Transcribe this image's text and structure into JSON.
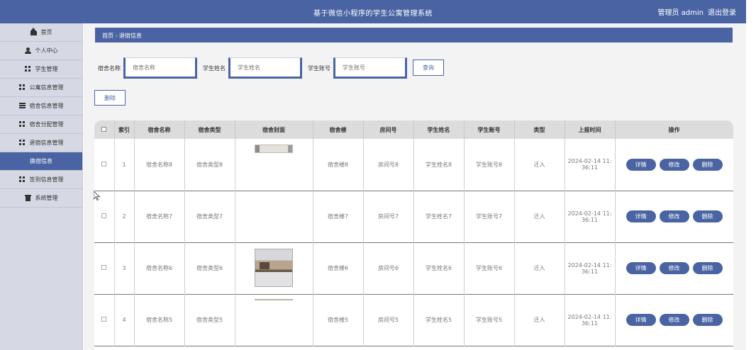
{
  "header": {
    "title": "基于微信小程序的学生公寓管理系统",
    "user_role": "管理员 admin",
    "logout": "退出登录"
  },
  "sidebar": {
    "items": [
      {
        "label": "首页",
        "icon": "home-icon",
        "active": false
      },
      {
        "label": "个人中心",
        "icon": "user-icon",
        "active": false
      },
      {
        "label": "学生管理",
        "icon": "grid-icon",
        "active": false
      },
      {
        "label": "公寓信息管理",
        "icon": "grid-icon",
        "active": false
      },
      {
        "label": "宿舍信息管理",
        "icon": "list-icon",
        "active": false
      },
      {
        "label": "宿舍分配管理",
        "icon": "grid-icon",
        "active": false
      },
      {
        "label": "退宿信息管理",
        "icon": "grid-icon",
        "active": false
      },
      {
        "label": "换宿信息",
        "icon": "",
        "active": true
      },
      {
        "label": "签到信息管理",
        "icon": "grid-icon",
        "active": false
      },
      {
        "label": "系统管理",
        "icon": "trash-icon",
        "active": false
      }
    ]
  },
  "breadcrumb": {
    "home": "首页",
    "sep": "-",
    "current": "退宿信息"
  },
  "search": {
    "fields": [
      {
        "label": "宿舍名称",
        "placeholder": "宿舍名称"
      },
      {
        "label": "学生姓名",
        "placeholder": "学生姓名"
      },
      {
        "label": "学生账号",
        "placeholder": "学生账号"
      }
    ],
    "query_label": "查询",
    "delete_label": "删除"
  },
  "table": {
    "headers": [
      "",
      "索引",
      "宿舍名称",
      "宿舍类型",
      "宿舍封面",
      "宿舍楼",
      "房间号",
      "学生姓名",
      "学生账号",
      "类型",
      "上报时间",
      "操作"
    ],
    "rows": [
      {
        "index": "1",
        "name": "宿舍名称8",
        "type": "宿舍类型8",
        "cover": "strip",
        "building": "宿舍楼8",
        "room": "房间号8",
        "student": "学生姓名8",
        "account": "学生账号8",
        "kind": "迁入",
        "time1": "2024-02-14 11:",
        "time2": "36:11"
      },
      {
        "index": "2",
        "name": "宿舍名称7",
        "type": "宿舍类型7",
        "cover": "",
        "building": "宿舍楼7",
        "room": "房间号7",
        "student": "学生姓名7",
        "account": "学生账号7",
        "kind": "迁入",
        "time1": "2024-02-14 11:",
        "time2": "36:11"
      },
      {
        "index": "3",
        "name": "宿舍名称6",
        "type": "宿舍类型6",
        "cover": "photo",
        "building": "宿舍楼6",
        "room": "房间号6",
        "student": "学生姓名6",
        "account": "学生账号6",
        "kind": "迁入",
        "time1": "2024-02-14 11:",
        "time2": "36:11"
      },
      {
        "index": "4",
        "name": "宿舍名称5",
        "type": "宿舍类型5",
        "cover": "line",
        "building": "宿舍楼5",
        "room": "房间号5",
        "student": "学生姓名5",
        "account": "学生账号5",
        "kind": "迁入",
        "time1": "2024-02-14 11:",
        "time2": "36:11"
      }
    ],
    "actions": {
      "detail": "详情",
      "edit": "修改",
      "delete": "删除"
    }
  },
  "colors": {
    "primary": "#4a64a3",
    "sidebar_bg": "#d6d9e3",
    "main_bg": "#f3f3f4"
  }
}
